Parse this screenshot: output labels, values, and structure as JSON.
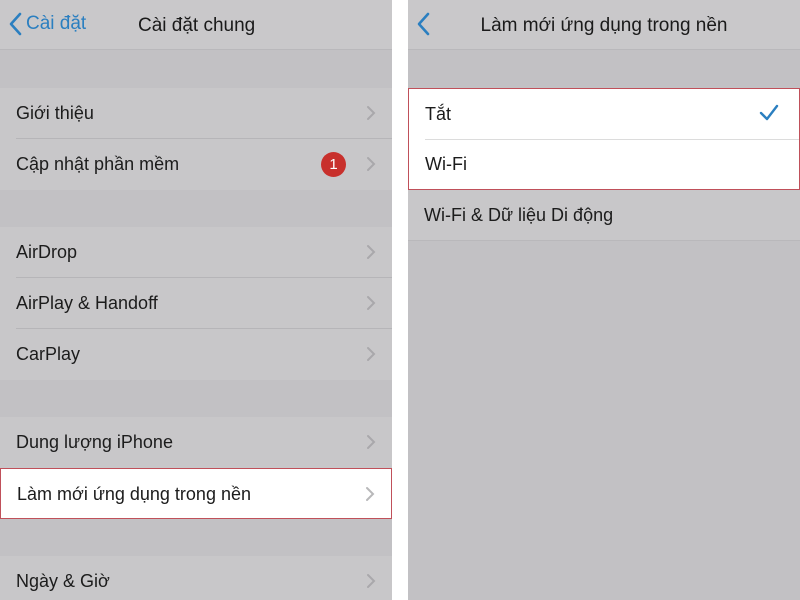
{
  "left": {
    "back_label": "Cài đặt",
    "title": "Cài đặt chung",
    "rows": [
      {
        "label": "Giới thiệu"
      },
      {
        "label": "Cập nhật phần mềm",
        "badge": "1"
      },
      {
        "label": "AirDrop"
      },
      {
        "label": "AirPlay & Handoff"
      },
      {
        "label": "CarPlay"
      },
      {
        "label": "Dung lượng iPhone"
      },
      {
        "label": "Làm mới ứng dụng trong nền"
      },
      {
        "label": "Ngày & Giờ"
      }
    ]
  },
  "right": {
    "title": "Làm mới ứng dụng trong nền",
    "options": [
      {
        "label": "Tắt",
        "selected": true
      },
      {
        "label": "Wi-Fi",
        "selected": false
      },
      {
        "label": "Wi-Fi & Dữ liệu Di động",
        "selected": false
      }
    ]
  },
  "colors": {
    "accent": "#2b7fc0",
    "badge": "#c8302c",
    "highlight_border": "#c0505a"
  }
}
